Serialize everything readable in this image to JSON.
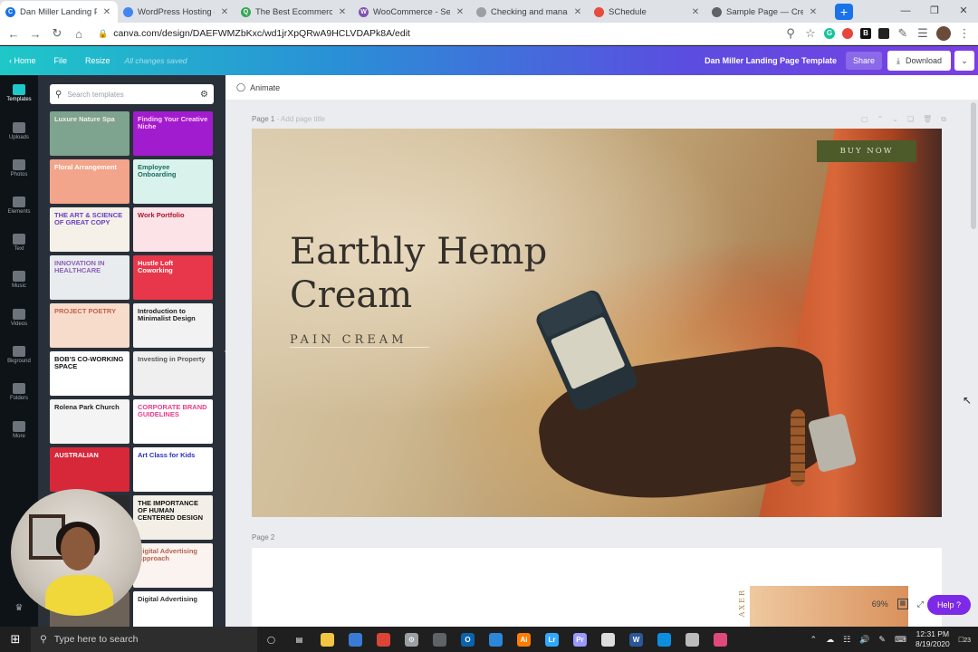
{
  "browser": {
    "tabs": [
      {
        "title": "Dan Miller Landing Pa",
        "color": "#1a73e8",
        "glyph": "C",
        "active": true
      },
      {
        "title": "WordPress Hosting (F",
        "color": "#4285f4",
        "glyph": "",
        "active": false
      },
      {
        "title": "The Best Ecommerce",
        "color": "#34a853",
        "glyph": "Q",
        "active": false
      },
      {
        "title": "WooCommerce - Sell",
        "color": "#7f54b3",
        "glyph": "W",
        "active": false
      },
      {
        "title": "Checking and manag",
        "color": "#9aa0a6",
        "glyph": "",
        "active": false
      },
      {
        "title": "SChedule",
        "color": "#e64c3c",
        "glyph": "",
        "active": false
      },
      {
        "title": "Sample Page — Crea",
        "color": "#5f6368",
        "glyph": "",
        "active": false
      }
    ],
    "url": "canva.com/design/DAEFWMZbKxc/wd1jrXpQRwA9HCLVDAPk8A/edit"
  },
  "canva_header": {
    "home": "Home",
    "file": "File",
    "resize": "Resize",
    "saved_status": "All changes saved",
    "design_title": "Dan Miller Landing Page Template",
    "share": "Share",
    "download": "Download"
  },
  "rail": [
    {
      "label": "Templates",
      "active": true
    },
    {
      "label": "Uploads"
    },
    {
      "label": "Photos"
    },
    {
      "label": "Elements"
    },
    {
      "label": "Text"
    },
    {
      "label": "Music"
    },
    {
      "label": "Videos"
    },
    {
      "label": "Bkground"
    },
    {
      "label": "Folders"
    },
    {
      "label": "More"
    }
  ],
  "templates_panel": {
    "search_placeholder": "Search templates",
    "items": [
      {
        "label": "Luxure Nature Spa",
        "bg": "#7ea38f",
        "fg": "#f4efe3"
      },
      {
        "label": "Finding Your Creative Niche",
        "bg": "#a21ccf",
        "fg": "#ffd1f2"
      },
      {
        "label": "Floral Arrangement",
        "bg": "#f2a58b",
        "fg": "#ffffff"
      },
      {
        "label": "Employee Onboarding",
        "bg": "#d9f3ec",
        "fg": "#1b6b61"
      },
      {
        "label": "THE ART & SCIENCE OF GREAT COPY",
        "bg": "#f5f1e8",
        "fg": "#6c3fc4"
      },
      {
        "label": "Work Portfolio",
        "bg": "#fbe3e8",
        "fg": "#b0132c"
      },
      {
        "label": "INNOVATION IN HEALTHCARE",
        "bg": "#e9ecef",
        "fg": "#8d5fb5"
      },
      {
        "label": "Hustle Loft Coworking",
        "bg": "#e8364a",
        "fg": "#ffffff"
      },
      {
        "label": "PROJECT POETRY",
        "bg": "#f7dccc",
        "fg": "#c2624a"
      },
      {
        "label": "Introduction to Minimalist Design",
        "bg": "#f2f2f2",
        "fg": "#222222"
      },
      {
        "label": "BOB'S CO-WORKING SPACE",
        "bg": "#ffffff",
        "fg": "#111111"
      },
      {
        "label": "Investing in Property",
        "bg": "#efefef",
        "fg": "#555555"
      },
      {
        "label": "Rolena Park Church",
        "bg": "#f4f4f4",
        "fg": "#222222"
      },
      {
        "label": "CORPORATE BRAND GUIDELINES",
        "bg": "#ffffff",
        "fg": "#e83a8a"
      },
      {
        "label": "AUSTRALIAN",
        "bg": "#d62839",
        "fg": "#ffffff"
      },
      {
        "label": "Art Class for Kids",
        "bg": "#ffffff",
        "fg": "#2a2fc4"
      },
      {
        "label": "",
        "bg": "#2a2a2a",
        "fg": "#ffffff"
      },
      {
        "label": "THE IMPORTANCE OF HUMAN CENTERED DESIGN",
        "bg": "#f3efe7",
        "fg": "#111111"
      },
      {
        "label": "",
        "bg": "#d9d3c7",
        "fg": "#333333"
      },
      {
        "label": "Digital Advertising Approach",
        "bg": "#fbf3ef",
        "fg": "#b2634e"
      },
      {
        "label": "",
        "bg": "#6d6258",
        "fg": "#ffffff"
      },
      {
        "label": "Digital Advertising",
        "bg": "#ffffff",
        "fg": "#333333"
      }
    ]
  },
  "editor": {
    "animate": "Animate",
    "page1_label": "Page 1",
    "page1_add_title": "- Add page title",
    "page2_label": "Page 2",
    "zoom": "69%",
    "help": "Help ?"
  },
  "design": {
    "headline": "Earthly Hemp Cream",
    "subheading": "PAIN CREAM",
    "cta": "BUY NOW",
    "page2_vertical_text": "AXER"
  },
  "taskbar": {
    "search_placeholder": "Type here to search",
    "apps": [
      {
        "name": "edge-legacy",
        "color": "#ffffff",
        "glyph": "◯"
      },
      {
        "name": "task-view",
        "color": "#ffffff",
        "glyph": "▤"
      },
      {
        "name": "explorer",
        "color": "#f4c542",
        "glyph": ""
      },
      {
        "name": "photos",
        "color": "#3a7bd5",
        "glyph": ""
      },
      {
        "name": "chrome",
        "color": "#db4437",
        "glyph": ""
      },
      {
        "name": "settings",
        "color": "#9aa0a6",
        "glyph": "⚙"
      },
      {
        "name": "calculator",
        "color": "#5f6368",
        "glyph": ""
      },
      {
        "name": "outlook",
        "color": "#0a64ad",
        "glyph": "O"
      },
      {
        "name": "store",
        "color": "#2b88d8",
        "glyph": ""
      },
      {
        "name": "illustrator",
        "color": "#ff7c00",
        "glyph": "Ai"
      },
      {
        "name": "lightroom",
        "color": "#31a8ff",
        "glyph": "Lr"
      },
      {
        "name": "premiere",
        "color": "#9999ff",
        "glyph": "Pr"
      },
      {
        "name": "app-icon",
        "color": "#dddddd",
        "glyph": ""
      },
      {
        "name": "word",
        "color": "#2b579a",
        "glyph": "W"
      },
      {
        "name": "edge",
        "color": "#0c8ee0",
        "glyph": ""
      },
      {
        "name": "app-circle",
        "color": "#bbbbbb",
        "glyph": ""
      },
      {
        "name": "app-pink",
        "color": "#e04a7a",
        "glyph": ""
      }
    ],
    "time": "12:31 PM",
    "date": "8/19/2020",
    "notifications": "23"
  }
}
